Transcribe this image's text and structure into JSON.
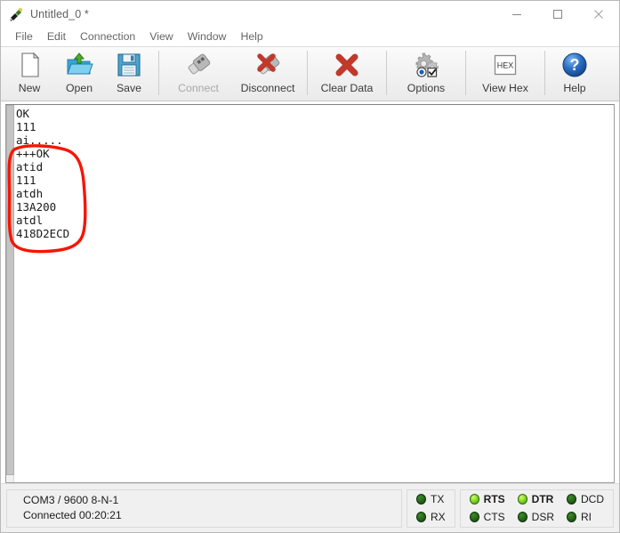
{
  "window": {
    "title": "Untitled_0 *",
    "icon": "serial-terminal-icon",
    "controls": {
      "minimize": "minimize-icon",
      "maximize": "maximize-icon",
      "close": "close-icon"
    }
  },
  "menubar": {
    "items": [
      {
        "label": "File"
      },
      {
        "label": "Edit"
      },
      {
        "label": "Connection"
      },
      {
        "label": "View"
      },
      {
        "label": "Window"
      },
      {
        "label": "Help"
      }
    ]
  },
  "toolbar": {
    "buttons": [
      {
        "label": "New",
        "icon": "new-document-icon",
        "enabled": true
      },
      {
        "label": "Open",
        "icon": "open-folder-icon",
        "enabled": true
      },
      {
        "label": "Save",
        "icon": "floppy-disk-icon",
        "enabled": true
      },
      {
        "label": "Connect",
        "icon": "usb-dongle-icon",
        "enabled": false
      },
      {
        "label": "Disconnect",
        "icon": "usb-dongle-red-x-icon",
        "enabled": true
      },
      {
        "label": "Clear Data",
        "icon": "red-x-icon",
        "enabled": true
      },
      {
        "label": "Options",
        "icon": "gears-options-icon",
        "enabled": true
      },
      {
        "label": "View Hex",
        "icon": "hex-box-icon",
        "enabled": true
      },
      {
        "label": "Help",
        "icon": "blue-question-help-icon",
        "enabled": true
      }
    ]
  },
  "terminal": {
    "lines": [
      "OK",
      "111",
      "ai.....",
      "+++OK",
      "atid",
      "111",
      "atdh",
      "13A200",
      "atdl",
      "418D2ECD"
    ],
    "text": "OK\n111\nai.....\n+++OK\natid\n111\natdh\n13A200\natdl\n418D2ECD",
    "annotation": {
      "type": "hand-drawn-red-circle",
      "color": "#f81400",
      "encloses": [
        "+++OK",
        "atid",
        "111",
        "atdh",
        "13A200",
        "atdl",
        "418D2ECD"
      ]
    }
  },
  "statusbar": {
    "port_info": "COM3 / 9600 8-N-1",
    "connection_status": "Connected 00:20:21",
    "txrx": [
      {
        "label": "TX",
        "on": false
      },
      {
        "label": "RX",
        "on": false
      }
    ],
    "signals": [
      {
        "label": "RTS",
        "on": true
      },
      {
        "label": "CTS",
        "on": false
      },
      {
        "label": "DTR",
        "on": true
      },
      {
        "label": "DSR",
        "on": false
      },
      {
        "label": "DCD",
        "on": false
      },
      {
        "label": "RI",
        "on": false
      }
    ]
  },
  "colors": {
    "led_on": "#8fe02c",
    "led_off": "#2a6b1c",
    "annotation_red": "#f81400",
    "toolbar_bg": "#f2f2f2",
    "statusbar_bg": "#f0f0f0"
  }
}
